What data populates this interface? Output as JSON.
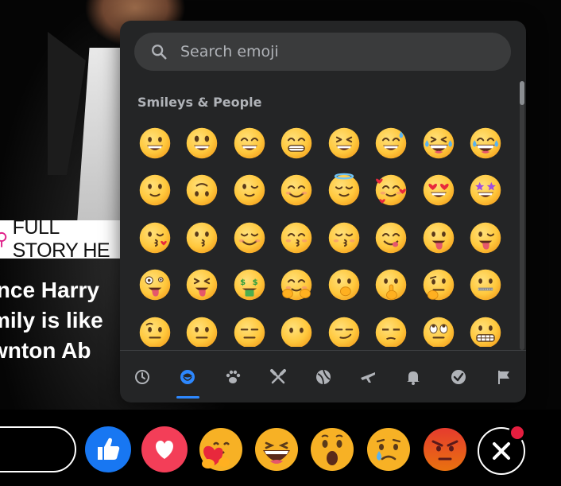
{
  "post": {
    "banner_pin_icon": "map-pin-icon",
    "banner_text": "FULL STORY HE",
    "headline_lines": [
      "ince Harry",
      "mily is like",
      "wnton Ab"
    ]
  },
  "picker": {
    "search": {
      "placeholder": "Search emoji",
      "value": "",
      "icon": "search-icon"
    },
    "section_title": "Smileys & People",
    "emojis": [
      "grinning",
      "grinning-big-eyes",
      "grinning-smiling-eyes",
      "beaming",
      "squinting",
      "grinning-sweat",
      "rolling-laughing",
      "tears-of-joy",
      "slightly-smiling",
      "upside-down",
      "winking",
      "smiling-eyes",
      "halo",
      "hearts",
      "heart-eyes",
      "star-struck",
      "blowing-kiss",
      "kissing",
      "smiling",
      "kissing-smiling-eyes",
      "kissing-closed-eyes",
      "savoring",
      "tongue-out",
      "winking-tongue",
      "zany",
      "squinting-tongue",
      "money-mouth",
      "hugging",
      "hand-over-mouth",
      "shushing",
      "thinking",
      "zipper-mouth",
      "raised-eyebrow",
      "neutral",
      "expressionless",
      "no-mouth",
      "smirking",
      "unamused",
      "eye-roll",
      "grimacing"
    ],
    "tabs": [
      {
        "name": "recent",
        "icon": "clock-icon",
        "active": false
      },
      {
        "name": "smileys",
        "icon": "smiley-icon",
        "active": true
      },
      {
        "name": "animals",
        "icon": "paw-icon",
        "active": false
      },
      {
        "name": "food",
        "icon": "fork-knife-icon",
        "active": false
      },
      {
        "name": "activities",
        "icon": "ball-icon",
        "active": false
      },
      {
        "name": "travel",
        "icon": "airplane-icon",
        "active": false
      },
      {
        "name": "objects",
        "icon": "bell-icon",
        "active": false
      },
      {
        "name": "symbols",
        "icon": "check-circle-icon",
        "active": false
      },
      {
        "name": "flags",
        "icon": "flag-icon",
        "active": false
      }
    ],
    "accent": "#2d88ff"
  },
  "reactions": [
    {
      "name": "like",
      "icon": "thumbs-up-icon",
      "color": "#1877f2"
    },
    {
      "name": "love",
      "icon": "heart-icon",
      "color": "#f33e58"
    },
    {
      "name": "care",
      "icon": "hug-icon",
      "color": "#f7b125"
    },
    {
      "name": "haha",
      "icon": "laughing-icon",
      "color": "#f7b125"
    },
    {
      "name": "wow",
      "icon": "surprised-icon",
      "color": "#f7b125"
    },
    {
      "name": "sad",
      "icon": "crying-icon",
      "color": "#f7b125"
    },
    {
      "name": "angry",
      "icon": "angry-icon",
      "color": "#e9710f"
    }
  ],
  "close": {
    "icon": "close-icon",
    "badge_color": "#e41e3f"
  }
}
